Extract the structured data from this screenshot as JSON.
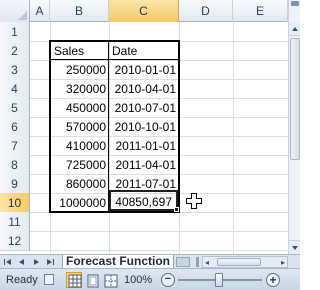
{
  "columns": [
    "A",
    "B",
    "C",
    "D",
    "E"
  ],
  "selected_column": "C",
  "rows": [
    "1",
    "2",
    "3",
    "4",
    "5",
    "6",
    "7",
    "8",
    "9",
    "10",
    "11",
    "12"
  ],
  "selected_row": "10",
  "table": {
    "headers": {
      "sales": "Sales",
      "date": "Date"
    },
    "records": [
      {
        "sales": "250000",
        "date": "2010-01-01"
      },
      {
        "sales": "320000",
        "date": "2010-04-01"
      },
      {
        "sales": "450000",
        "date": "2010-07-01"
      },
      {
        "sales": "570000",
        "date": "2010-10-01"
      },
      {
        "sales": "410000",
        "date": "2011-01-01"
      },
      {
        "sales": "725000",
        "date": "2011-04-01"
      },
      {
        "sales": "860000",
        "date": "2011-07-01"
      },
      {
        "sales": "1000000",
        "date": "40850,697"
      }
    ]
  },
  "sheet_tab": {
    "label": "Forecast Function"
  },
  "status": {
    "ready_label": "Ready",
    "zoom_label": "100%",
    "zoom_minus": "−",
    "zoom_plus": "+"
  },
  "icons": {
    "tab_first": "first-sheet-icon",
    "tab_prev": "prev-sheet-icon",
    "tab_next": "next-sheet-icon",
    "tab_last": "last-sheet-icon",
    "cursor": "cross-cursor-icon"
  },
  "colors": {
    "selection_header": "#f6c965",
    "header_background": "#e3e9f0",
    "gridline": "#d9dee6",
    "status_bar": "#c9d6e5"
  }
}
